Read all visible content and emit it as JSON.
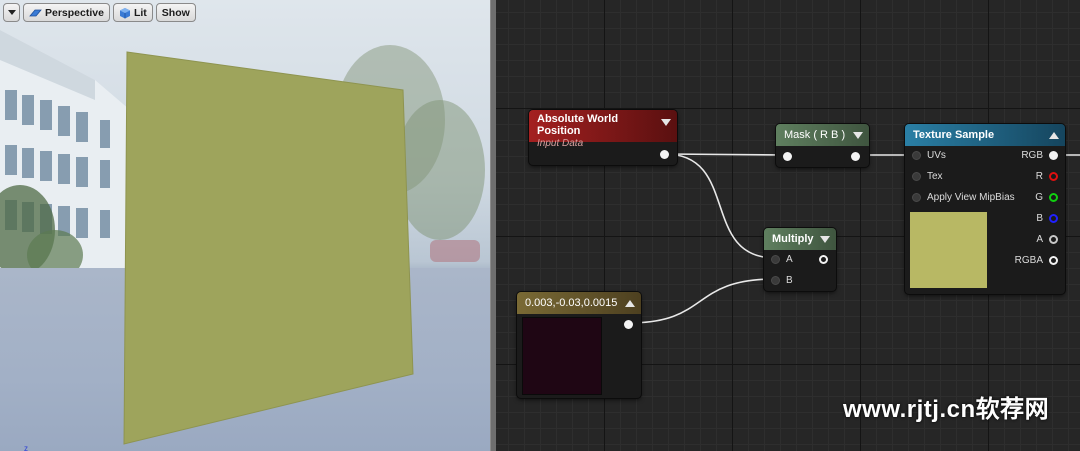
{
  "viewport": {
    "toolbar": {
      "perspective_label": "Perspective",
      "lit_label": "Lit",
      "show_label": "Show"
    },
    "axis_label": "z",
    "plane_color": "#9ea45c"
  },
  "graph": {
    "nodes": {
      "absolute_world_position": {
        "title": "Absolute World Position",
        "subtitle": "Input Data",
        "header_color": "#8b1a1a"
      },
      "mask": {
        "title": "Mask ( R B )",
        "header_color": "#4d6b4d"
      },
      "multiply": {
        "title": "Multiply",
        "header_color": "#4d6b4d",
        "inputs": [
          "A",
          "B"
        ]
      },
      "constant": {
        "title": "0.003,-0.03,0.0015",
        "header_color": "#6b5a2a",
        "preview_color": "#1f0614"
      },
      "texture_sample": {
        "title": "Texture Sample",
        "header_color": "#1e6b8c",
        "inputs": [
          "UVs",
          "Tex",
          "Apply View MipBias"
        ],
        "outputs": [
          "RGB",
          "R",
          "G",
          "B",
          "A",
          "RGBA"
        ],
        "preview_color": "#b8b864"
      }
    }
  },
  "watermark": "www.rjtj.cn软荐网"
}
